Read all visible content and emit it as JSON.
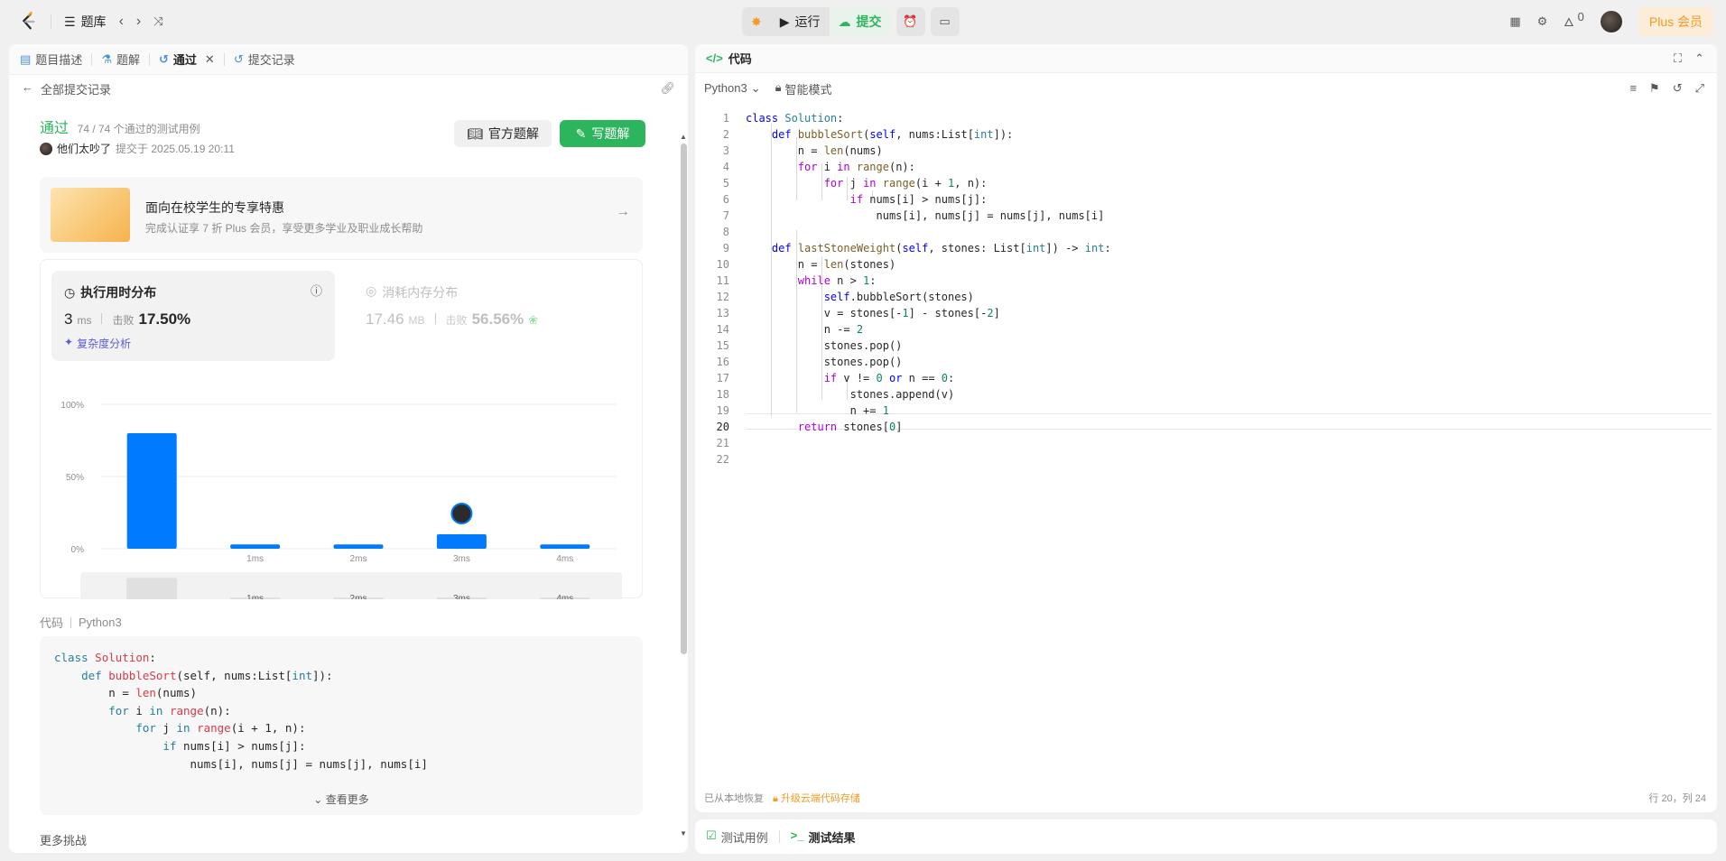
{
  "topbar": {
    "problem_bank": "题库",
    "run_label": "运行",
    "submit_label": "提交",
    "fire_count": "0",
    "plus_label": "Plus 会员"
  },
  "left": {
    "tabs": [
      {
        "label": "题目描述"
      },
      {
        "label": "题解"
      },
      {
        "label": "通过"
      },
      {
        "label": "提交记录"
      }
    ],
    "back_label": "全部提交记录",
    "status": "通过",
    "testcases": "74 / 74 个通过的测试用例",
    "author": "他们太吵了",
    "submitted_at": "提交于 2025.05.19 20:11",
    "official_btn": "官方题解",
    "write_btn": "写题解",
    "promo_title": "面向在校学生的专享特惠",
    "promo_sub": "完成认证享 7 折 Plus 会员，享受更多学业及职业成长帮助",
    "runtime": {
      "title": "执行用时分布",
      "value": "3",
      "unit": "ms",
      "beat_label": "击败",
      "beat_value": "17.50%",
      "analysis": "复杂度分析"
    },
    "memory": {
      "title": "消耗内存分布",
      "value": "17.46",
      "unit": "MB",
      "beat_label": "击败",
      "beat_value": "56.56%"
    },
    "code_label": "代码",
    "code_lang": "Python3",
    "see_more": "查看更多",
    "more_challenges": "更多挑战"
  },
  "chart_data": {
    "type": "bar",
    "categories": [
      "",
      "1ms",
      "2ms",
      "3ms",
      "4ms"
    ],
    "values": [
      80,
      3,
      3,
      10,
      3
    ],
    "highlight_index": 3,
    "ylim": [
      0,
      100
    ],
    "yticks": [
      "0%",
      "50%",
      "100%"
    ],
    "color": "#007aff",
    "grid": true
  },
  "right": {
    "title": "代码",
    "lang": "Python3",
    "mode": "智能模式",
    "footer_restore": "已从本地恢复",
    "footer_upgrade": "升级云端代码存储",
    "cursor": "行 20，列 24"
  },
  "bottom": {
    "tab1": "测试用例",
    "tab2": "测试结果"
  }
}
